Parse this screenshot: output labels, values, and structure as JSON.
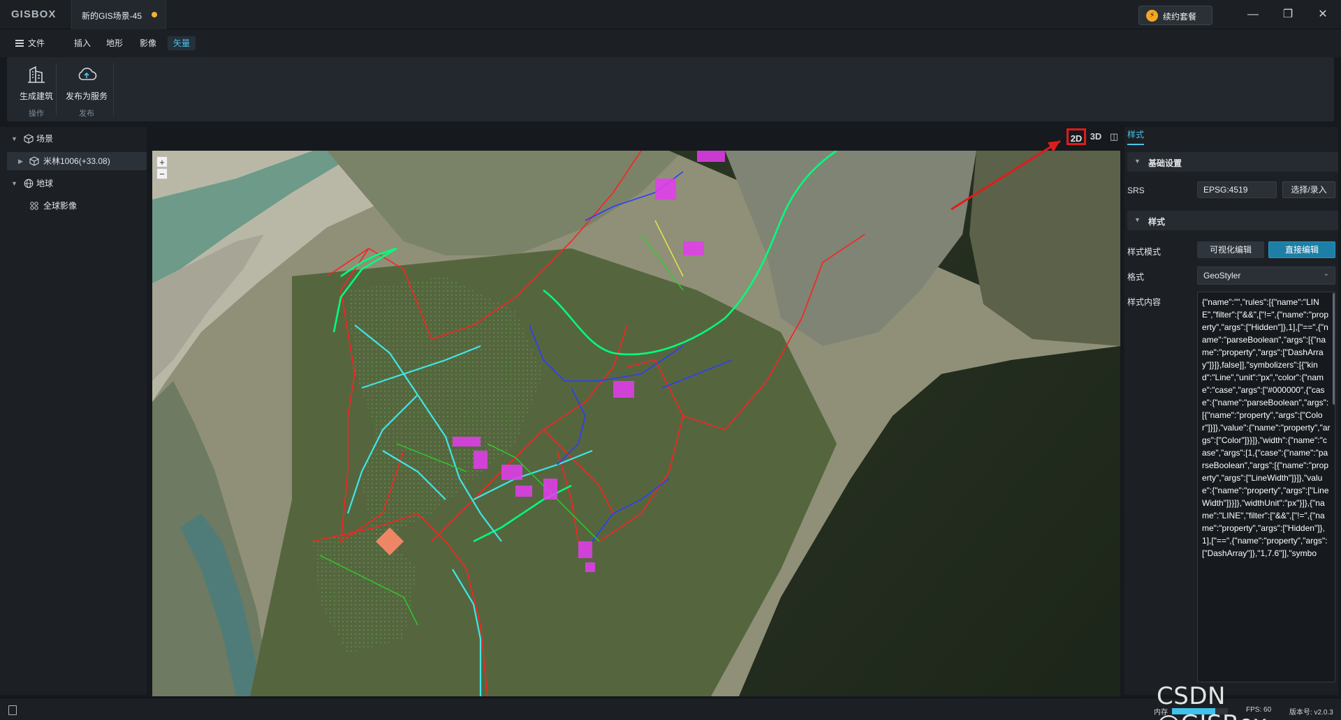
{
  "app": {
    "logo": "GISBOX",
    "tab_title": "新的GIS场景-45",
    "renew_label": "续约套餐"
  },
  "window_controls": {
    "minimize": "—",
    "restore": "❐",
    "close": "✕"
  },
  "menu": {
    "file": "文件",
    "items": [
      "插入",
      "地形",
      "影像",
      "矢量"
    ],
    "active_index": 3
  },
  "ribbon": {
    "buttons": [
      {
        "label": "生成建筑",
        "group": "操作",
        "icon": "building-icon"
      },
      {
        "label": "发布为服务",
        "group": "发布",
        "icon": "cloud-upload-icon"
      }
    ]
  },
  "scene_tree": {
    "scene_label": "场景",
    "layer_label": "米林1006(+33.08)",
    "earth_label": "地球",
    "imagery_label": "全球影像"
  },
  "view_modes": {
    "two_d": "2D",
    "three_d": "3D",
    "split": "◫"
  },
  "map": {
    "zoom_in": "+",
    "zoom_out": "−"
  },
  "style_panel": {
    "tab_label": "样式",
    "basic_section": "基础设置",
    "srs_label": "SRS",
    "srs_value": "EPSG:4519",
    "srs_button": "选择/录入",
    "style_section": "样式",
    "mode_label": "样式模式",
    "mode_visual": "可视化编辑",
    "mode_direct": "直接编辑",
    "format_label": "格式",
    "format_value": "GeoStyler",
    "content_label": "样式内容",
    "content_value": "{\"name\":\"\",\"rules\":[{\"name\":\"LINE\",\"filter\":[\"&&\",[\"!=\",{\"name\":\"property\",\"args\":[\"Hidden\"]},1],[\"==\",{\"name\":\"parseBoolean\",\"args\":[{\"name\":\"property\",\"args\":[\"DashArray\"]}]},false]],\"symbolizers\":[{\"kind\":\"Line\",\"unit\":\"px\",\"color\":{\"name\":\"case\",\"args\":[\"#000000\",{\"case\":{\"name\":\"parseBoolean\",\"args\":[{\"name\":\"property\",\"args\":[\"Color\"]}]},\"value\":{\"name\":\"property\",\"args\":[\"Color\"]}}]},\"width\":{\"name\":\"case\",\"args\":[1,{\"case\":{\"name\":\"parseBoolean\",\"args\":[{\"name\":\"property\",\"args\":[\"LineWidth\"]}]},\"value\":{\"name\":\"property\",\"args\":[\"LineWidth\"]}}]},\"widthUnit\":\"px\"}]},{\"name\":\"LINE\",\"filter\":[\"&&\",[\"!=\",{\"name\":\"property\",\"args\":[\"Hidden\"]},1],[\"==\",{\"name\":\"property\",\"args\":[\"DashArray\"]},\"1,7.6\"]],\"symbo"
  },
  "status": {
    "memory_label": "内存",
    "memory_fraction": 0.78,
    "fps": "FPS: 60",
    "version": "版本号: v2.0.3"
  },
  "watermark": "CSDN @GISBox"
}
